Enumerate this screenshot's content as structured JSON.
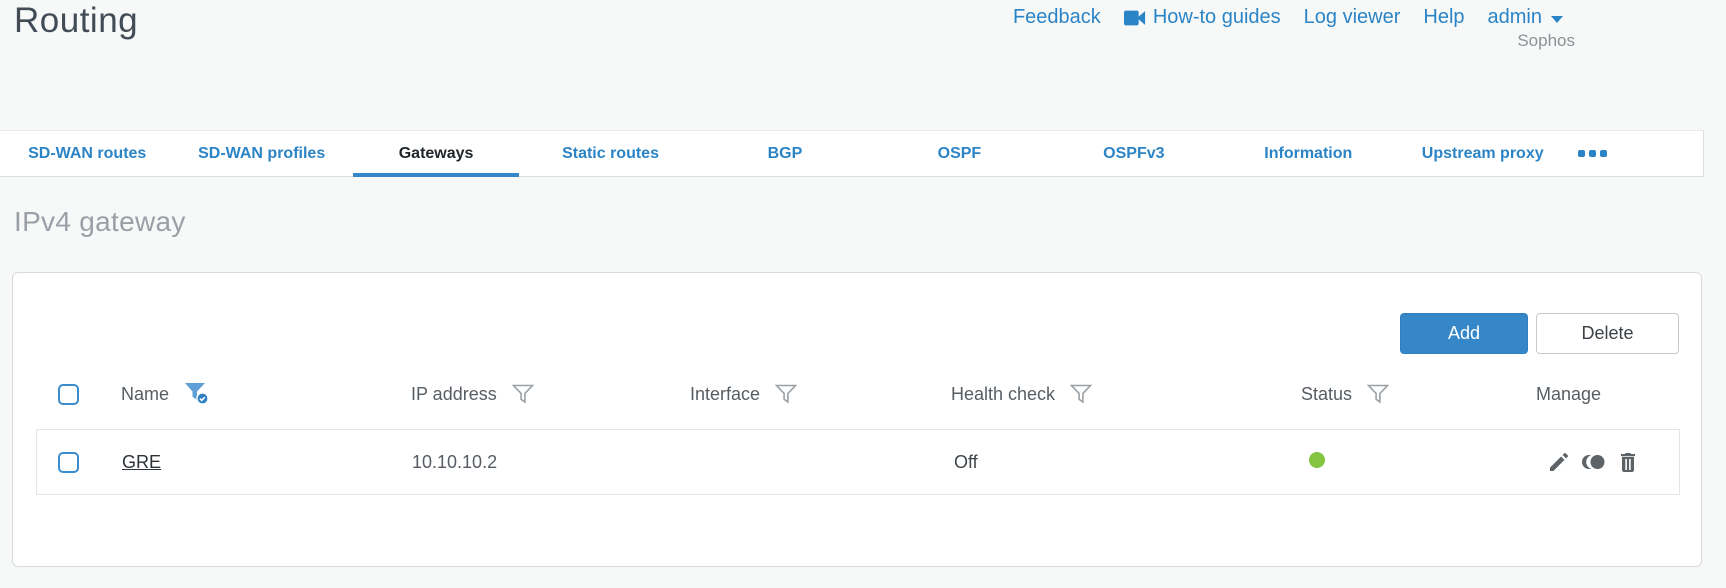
{
  "page": {
    "title": "Routing",
    "brand": "Sophos"
  },
  "nav": {
    "links": [
      {
        "label": "Feedback"
      },
      {
        "label": "How-to guides",
        "icon": "video-camera-icon"
      },
      {
        "label": "Log viewer"
      },
      {
        "label": "Help"
      }
    ],
    "user_menu": {
      "label": "admin",
      "icon": "chevron-down-icon"
    }
  },
  "tabs": {
    "items": [
      {
        "label": "SD-WAN routes",
        "active": false
      },
      {
        "label": "SD-WAN profiles",
        "active": false
      },
      {
        "label": "Gateways",
        "active": true
      },
      {
        "label": "Static routes",
        "active": false
      },
      {
        "label": "BGP",
        "active": false
      },
      {
        "label": "OSPF",
        "active": false
      },
      {
        "label": "OSPFv3",
        "active": false
      },
      {
        "label": "Information",
        "active": false
      },
      {
        "label": "Upstream proxy",
        "active": false
      }
    ],
    "more_icon": "ellipsis-icon"
  },
  "section": {
    "heading": "IPv4 gateway"
  },
  "toolbar": {
    "add_label": "Add",
    "delete_label": "Delete"
  },
  "table": {
    "columns": [
      {
        "label": "Name",
        "filter": "active"
      },
      {
        "label": "IP address",
        "filter": "inactive"
      },
      {
        "label": "Interface",
        "filter": "inactive"
      },
      {
        "label": "Health check",
        "filter": "inactive"
      },
      {
        "label": "Status",
        "filter": "inactive"
      },
      {
        "label": "Manage",
        "filter": "none"
      }
    ],
    "rows": [
      {
        "name": "GRE",
        "ip_address": "10.10.10.2",
        "interface": "",
        "health_check": "Off",
        "status": "up",
        "manage_icons": [
          "edit",
          "clone",
          "delete"
        ]
      }
    ]
  },
  "colors": {
    "accent_blue": "#2b84c6",
    "button_blue": "#3687c8",
    "status_green": "#84c43f",
    "active_tab_underline": "#3687c8"
  }
}
